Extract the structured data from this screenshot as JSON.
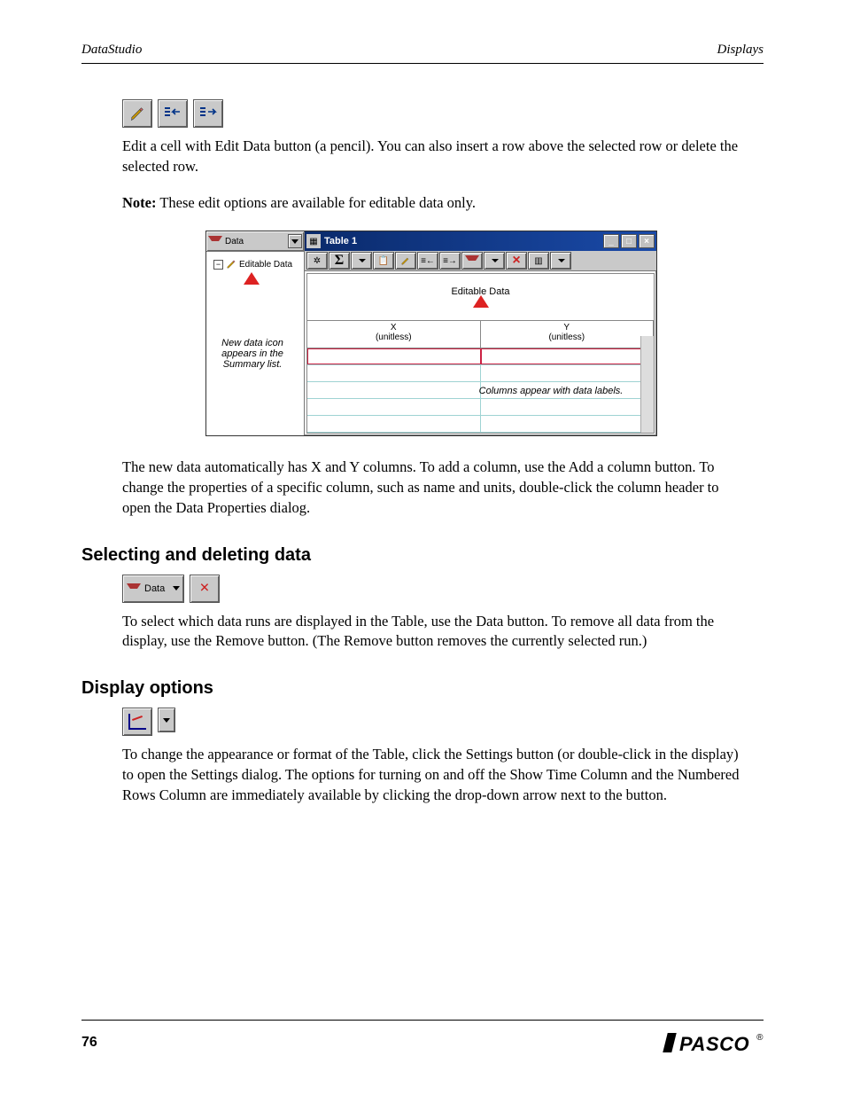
{
  "header": {
    "left": "DataStudio",
    "right": "Displays"
  },
  "sections": {
    "edit": {
      "body": "Edit a cell with Edit Data button (a pencil). You can also insert a row above the selected row or delete the selected row.",
      "note_label": "Note:",
      "note": "These edit options are available for editable data only."
    },
    "window": {
      "data_label": "Data",
      "run_label": "Editable Data",
      "title": "Table 1",
      "tree_arrow_caption": "New data icon appears in the Summary list.",
      "table_arrow_caption": "Columns appear with data labels.",
      "header1": "Editable Data",
      "colX": {
        "name": "X",
        "unit": "(unitless)"
      },
      "colY": {
        "name": "Y",
        "unit": "(unitless)"
      },
      "body": "The new data automatically has X and Y columns. To add a column, use the Add a column button. To change the properties of a specific column, such as name and units, double-click the column header to open the Data Properties dialog."
    },
    "select_delete": {
      "title": "Selecting and deleting data",
      "data_btn_label": "Data",
      "body": "To select which data runs are displayed in the Table, use the Data button. To remove all data from the display, use the Remove button. (The Remove button removes the currently selected run.)"
    },
    "display_options": {
      "title": "Display options",
      "body": "To change the appearance or format of the Table, click the Settings button (or double-click in the display) to open the Settings dialog. The options for turning on and off the Show Time Column and the Numbered Rows Column are immediately available by clicking the drop-down arrow next to the button."
    }
  },
  "footer": {
    "page": "76",
    "brand": "PASCO",
    "reg": "®"
  }
}
